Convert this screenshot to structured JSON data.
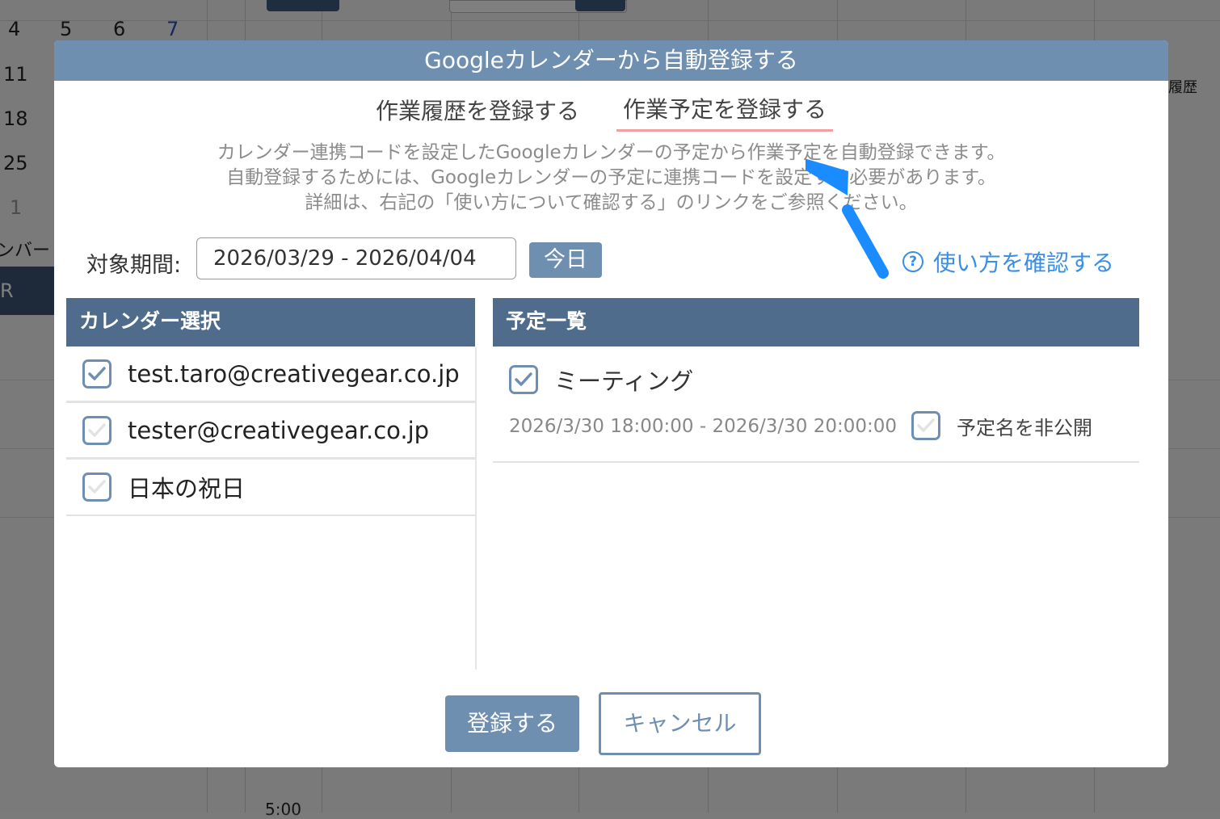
{
  "background": {
    "mini_calendar_rows": [
      [
        "4",
        "5",
        "6",
        "7"
      ],
      [
        "11"
      ],
      [
        "18"
      ],
      [
        "25"
      ],
      [
        "1"
      ]
    ],
    "member_label": "ンバー",
    "member_bar_text": "R",
    "history_label": "履歴",
    "time_label": "5:00"
  },
  "modal": {
    "title": "Googleカレンダーから自動登録する",
    "tabs": [
      {
        "label": "作業履歴を登録する",
        "active": false
      },
      {
        "label": "作業予定を登録する",
        "active": true
      }
    ],
    "description": [
      "カレンダー連携コードを設定したGoogleカレンダーの予定から作業予定を自動登録できます。",
      "自動登録するためには、Googleカレンダーの予定に連携コードを設定する必要があります。",
      "詳細は、右記の「使い方について確認する」のリンクをご参照ください。"
    ],
    "period": {
      "label": "対象期間:",
      "value": "2026/03/29 - 2026/04/04",
      "today_button": "今日"
    },
    "help_link": {
      "icon": "?",
      "label": "使い方を確認する"
    },
    "calendar_panel": {
      "title": "カレンダー選択",
      "items": [
        {
          "label": "test.taro@creativegear.co.jp",
          "checked": true
        },
        {
          "label": "tester@creativegear.co.jp",
          "checked": false
        },
        {
          "label": "日本の祝日",
          "checked": false
        }
      ]
    },
    "event_panel": {
      "title": "予定一覧",
      "events": [
        {
          "title": "ミーティング",
          "checked": true,
          "time": "2026/3/30 18:00:00 - 2026/3/30 20:00:00",
          "private_label": "予定名を非公開",
          "private_checked": false
        }
      ]
    },
    "buttons": {
      "submit": "登録する",
      "cancel": "キャンセル"
    }
  },
  "colors": {
    "header": "#6f8fb1",
    "panel_header": "#4f6c8c",
    "link": "#3a8ee6",
    "arrow": "#1a8cff",
    "active_tab_underline": "#f0a0a0"
  }
}
